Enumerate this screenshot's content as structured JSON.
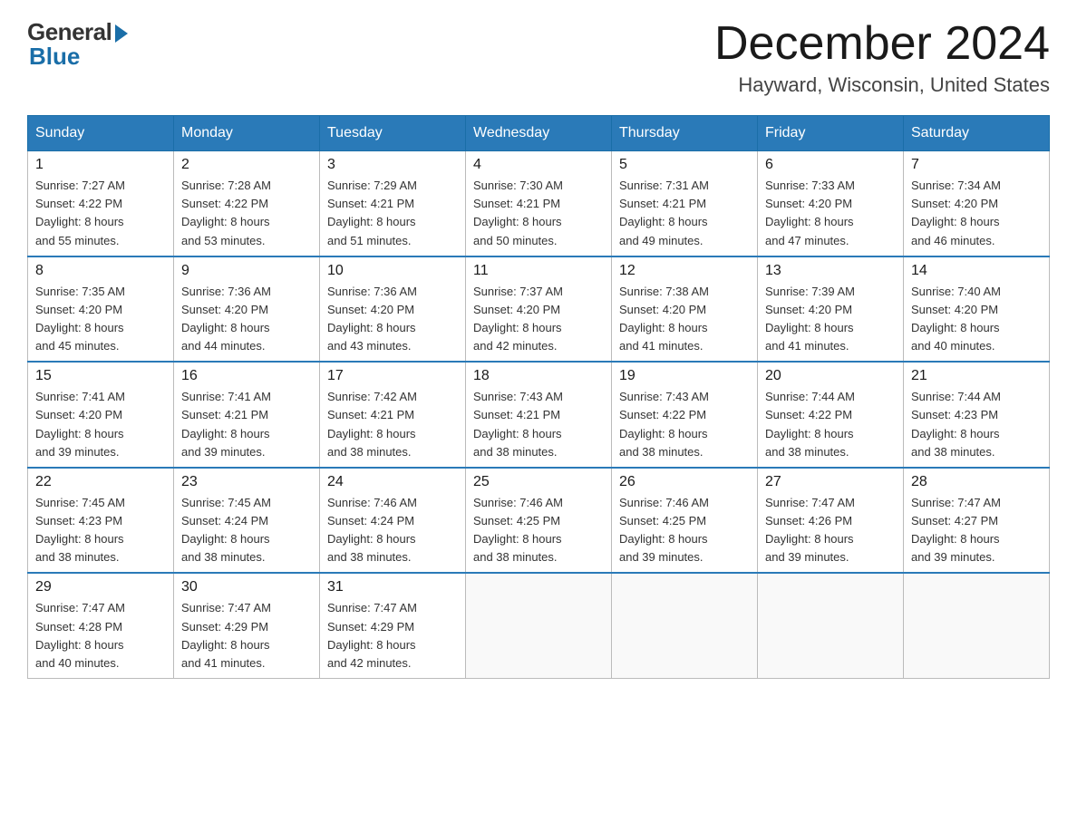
{
  "logo": {
    "general": "General",
    "blue": "Blue"
  },
  "header": {
    "month": "December 2024",
    "location": "Hayward, Wisconsin, United States"
  },
  "weekdays": [
    "Sunday",
    "Monday",
    "Tuesday",
    "Wednesday",
    "Thursday",
    "Friday",
    "Saturday"
  ],
  "weeks": [
    [
      {
        "day": "1",
        "sunrise": "7:27 AM",
        "sunset": "4:22 PM",
        "daylight": "8 hours and 55 minutes."
      },
      {
        "day": "2",
        "sunrise": "7:28 AM",
        "sunset": "4:22 PM",
        "daylight": "8 hours and 53 minutes."
      },
      {
        "day": "3",
        "sunrise": "7:29 AM",
        "sunset": "4:21 PM",
        "daylight": "8 hours and 51 minutes."
      },
      {
        "day": "4",
        "sunrise": "7:30 AM",
        "sunset": "4:21 PM",
        "daylight": "8 hours and 50 minutes."
      },
      {
        "day": "5",
        "sunrise": "7:31 AM",
        "sunset": "4:21 PM",
        "daylight": "8 hours and 49 minutes."
      },
      {
        "day": "6",
        "sunrise": "7:33 AM",
        "sunset": "4:20 PM",
        "daylight": "8 hours and 47 minutes."
      },
      {
        "day": "7",
        "sunrise": "7:34 AM",
        "sunset": "4:20 PM",
        "daylight": "8 hours and 46 minutes."
      }
    ],
    [
      {
        "day": "8",
        "sunrise": "7:35 AM",
        "sunset": "4:20 PM",
        "daylight": "8 hours and 45 minutes."
      },
      {
        "day": "9",
        "sunrise": "7:36 AM",
        "sunset": "4:20 PM",
        "daylight": "8 hours and 44 minutes."
      },
      {
        "day": "10",
        "sunrise": "7:36 AM",
        "sunset": "4:20 PM",
        "daylight": "8 hours and 43 minutes."
      },
      {
        "day": "11",
        "sunrise": "7:37 AM",
        "sunset": "4:20 PM",
        "daylight": "8 hours and 42 minutes."
      },
      {
        "day": "12",
        "sunrise": "7:38 AM",
        "sunset": "4:20 PM",
        "daylight": "8 hours and 41 minutes."
      },
      {
        "day": "13",
        "sunrise": "7:39 AM",
        "sunset": "4:20 PM",
        "daylight": "8 hours and 41 minutes."
      },
      {
        "day": "14",
        "sunrise": "7:40 AM",
        "sunset": "4:20 PM",
        "daylight": "8 hours and 40 minutes."
      }
    ],
    [
      {
        "day": "15",
        "sunrise": "7:41 AM",
        "sunset": "4:20 PM",
        "daylight": "8 hours and 39 minutes."
      },
      {
        "day": "16",
        "sunrise": "7:41 AM",
        "sunset": "4:21 PM",
        "daylight": "8 hours and 39 minutes."
      },
      {
        "day": "17",
        "sunrise": "7:42 AM",
        "sunset": "4:21 PM",
        "daylight": "8 hours and 38 minutes."
      },
      {
        "day": "18",
        "sunrise": "7:43 AM",
        "sunset": "4:21 PM",
        "daylight": "8 hours and 38 minutes."
      },
      {
        "day": "19",
        "sunrise": "7:43 AM",
        "sunset": "4:22 PM",
        "daylight": "8 hours and 38 minutes."
      },
      {
        "day": "20",
        "sunrise": "7:44 AM",
        "sunset": "4:22 PM",
        "daylight": "8 hours and 38 minutes."
      },
      {
        "day": "21",
        "sunrise": "7:44 AM",
        "sunset": "4:23 PM",
        "daylight": "8 hours and 38 minutes."
      }
    ],
    [
      {
        "day": "22",
        "sunrise": "7:45 AM",
        "sunset": "4:23 PM",
        "daylight": "8 hours and 38 minutes."
      },
      {
        "day": "23",
        "sunrise": "7:45 AM",
        "sunset": "4:24 PM",
        "daylight": "8 hours and 38 minutes."
      },
      {
        "day": "24",
        "sunrise": "7:46 AM",
        "sunset": "4:24 PM",
        "daylight": "8 hours and 38 minutes."
      },
      {
        "day": "25",
        "sunrise": "7:46 AM",
        "sunset": "4:25 PM",
        "daylight": "8 hours and 38 minutes."
      },
      {
        "day": "26",
        "sunrise": "7:46 AM",
        "sunset": "4:25 PM",
        "daylight": "8 hours and 39 minutes."
      },
      {
        "day": "27",
        "sunrise": "7:47 AM",
        "sunset": "4:26 PM",
        "daylight": "8 hours and 39 minutes."
      },
      {
        "day": "28",
        "sunrise": "7:47 AM",
        "sunset": "4:27 PM",
        "daylight": "8 hours and 39 minutes."
      }
    ],
    [
      {
        "day": "29",
        "sunrise": "7:47 AM",
        "sunset": "4:28 PM",
        "daylight": "8 hours and 40 minutes."
      },
      {
        "day": "30",
        "sunrise": "7:47 AM",
        "sunset": "4:29 PM",
        "daylight": "8 hours and 41 minutes."
      },
      {
        "day": "31",
        "sunrise": "7:47 AM",
        "sunset": "4:29 PM",
        "daylight": "8 hours and 42 minutes."
      },
      null,
      null,
      null,
      null
    ]
  ],
  "labels": {
    "sunrise": "Sunrise:",
    "sunset": "Sunset:",
    "daylight": "Daylight:"
  }
}
